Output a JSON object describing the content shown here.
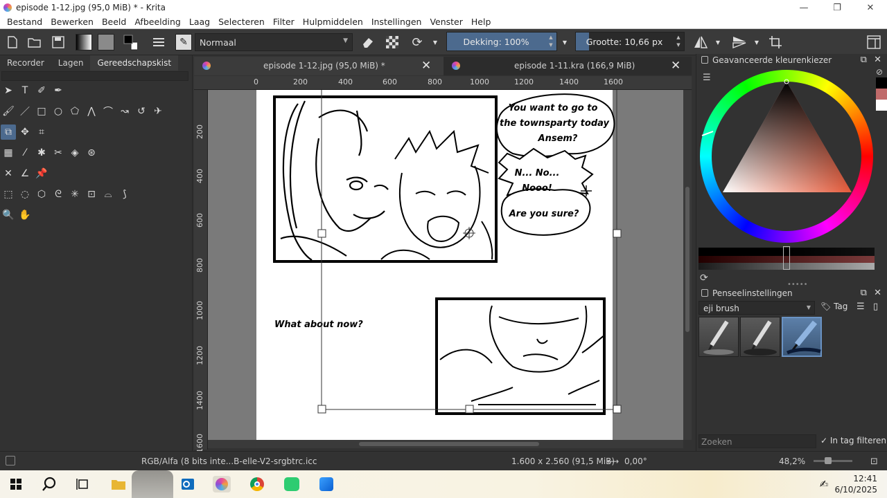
{
  "window": {
    "title": "episode 1-12.jpg (95,0 MiB) * - Krita",
    "minimize": "—",
    "restore": "❐",
    "close": "✕"
  },
  "menu": [
    "Bestand",
    "Bewerken",
    "Beeld",
    "Afbeelding",
    "Laag",
    "Selecteren",
    "Filter",
    "Hulpmiddelen",
    "Instellingen",
    "Venster",
    "Help"
  ],
  "toolbar": {
    "blend_mode": "Normaal",
    "opacity_label": "Dekking: 100%",
    "opacity_value": 100,
    "size_label": "Grootte: 10,66 px",
    "size_fill": 0.12
  },
  "left_tabs": [
    "Recorder",
    "Lagen",
    "Gereedschapskist"
  ],
  "documents": [
    {
      "label": "episode 1-12.jpg (95,0 MiB) *",
      "close": "✕",
      "active": true
    },
    {
      "label": "episode 1-11.kra (166,9 MiB)",
      "close": "✕",
      "active": false
    }
  ],
  "ruler": {
    "h": [
      "0",
      "200",
      "400",
      "600",
      "800",
      "1000",
      "1200",
      "1400",
      "1600"
    ],
    "v": [
      "200",
      "400",
      "600",
      "800",
      "1000",
      "1200",
      "1400",
      "1600"
    ]
  },
  "comic": {
    "bubble1": [
      "You want to go to",
      "the townsparty today",
      "Ansem?"
    ],
    "bubble2": [
      "N... No...",
      "Nooo!"
    ],
    "bubble3": "Are you sure?",
    "caption": "What about now?"
  },
  "color_selector": {
    "title": "Geavanceerde kleurenkiezer",
    "swatches": [
      "#000000",
      "#c06a6a",
      "#ffffff"
    ]
  },
  "brush_settings": {
    "title": "Penseelinstellingen",
    "preset": "eji brush",
    "tag_label": "Tag",
    "search_placeholder": "Zoeken",
    "filter_label": "In tag filteren"
  },
  "status": {
    "color_space": "RGB/Alfa (8 bits inte...B-elle-V2-srgbtrc.icc",
    "image_size": "1.600 x 2.560 (91,5 MiB)",
    "rotation": "0,00°",
    "zoom": "48,2%"
  },
  "taskbar": {
    "time": "12:41",
    "date": "6/10/2025"
  }
}
